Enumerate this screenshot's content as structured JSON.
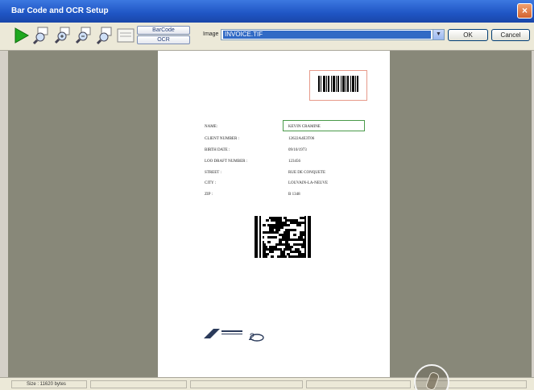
{
  "window": {
    "title": "Bar Code and OCR Setup",
    "close_glyph": "×"
  },
  "toolbar": {
    "tools": [
      {
        "icon": "play-icon",
        "color": "#1fa81f"
      },
      {
        "icon": "zoom-region-icon"
      },
      {
        "icon": "zoom-in-icon"
      },
      {
        "icon": "zoom-out-icon"
      },
      {
        "icon": "zoom-fit-icon"
      },
      {
        "icon": "zoom-1to1-icon"
      }
    ],
    "barcode_label": "BarCode",
    "ocr_label": "OCR",
    "image_label": "Image",
    "image_value": "INVOICE.TIF",
    "ok_label": "OK",
    "cancel_label": "Cancel"
  },
  "document": {
    "fields": [
      {
        "label": "NAME:",
        "value": "KEVIN CRAMINE"
      },
      {
        "label": "CLIENT NUMBER :",
        "value": "12622A4E3T06"
      },
      {
        "label": "BIRTH DATE :",
        "value": "09/10/1973"
      },
      {
        "label": "LOO DRAFT NUMBER :",
        "value": "123456"
      },
      {
        "label": "STREET :",
        "value": "RUE DE CONQUETE"
      },
      {
        "label": "CITY :",
        "value": "LOUVAIN-LA-NEUVE"
      },
      {
        "label": "ZIP :",
        "value": "B 1348"
      }
    ]
  },
  "status": {
    "size_text": "Size : 11620 bytes"
  },
  "colors": {
    "title_bar": "#1f55c4",
    "selection": "#316ac5",
    "workspace": "#888879"
  }
}
